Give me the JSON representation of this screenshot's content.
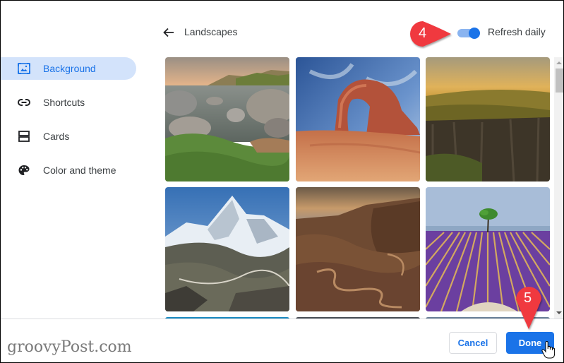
{
  "sidebar": {
    "items": [
      {
        "label": "Background",
        "icon": "image-icon",
        "active": true
      },
      {
        "label": "Shortcuts",
        "icon": "link-icon",
        "active": false
      },
      {
        "label": "Cards",
        "icon": "cards-icon",
        "active": false
      },
      {
        "label": "Color and theme",
        "icon": "palette-icon",
        "active": false
      }
    ]
  },
  "header": {
    "back_icon": "arrow-left-icon",
    "title": "Landscapes",
    "toggle_label": "Refresh daily",
    "toggle_on": true
  },
  "gallery": {
    "tiles": [
      {
        "name": "lake-rocks"
      },
      {
        "name": "red-arch"
      },
      {
        "name": "canyon-cliffs"
      },
      {
        "name": "snowy-mountain"
      },
      {
        "name": "winding-road-valley"
      },
      {
        "name": "lavender-field-tree"
      }
    ]
  },
  "footer": {
    "cancel_label": "Cancel",
    "done_label": "Done"
  },
  "annotations": {
    "callout_4": "4",
    "callout_5": "5"
  },
  "watermark": "groovyPost.com",
  "colors": {
    "accent": "#1a73e8",
    "selected_bg": "#d3e3fb",
    "callout_red": "#f0393f"
  }
}
